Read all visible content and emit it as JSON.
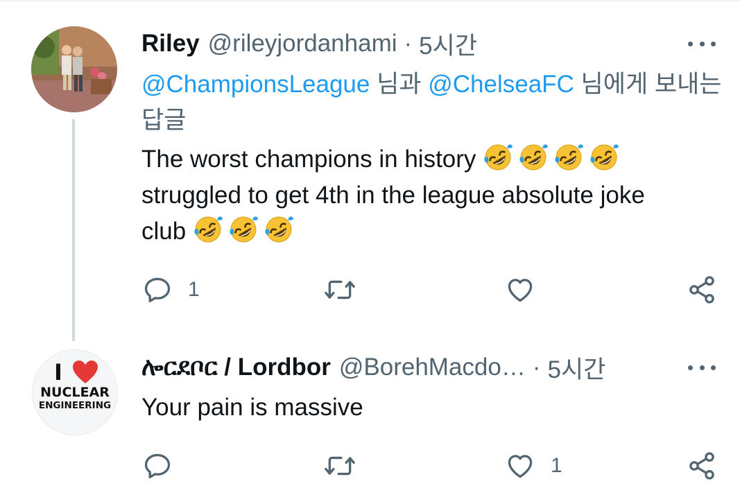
{
  "tweets": [
    {
      "name": "Riley",
      "handle": "@rileyjordanhami",
      "time": "5시간",
      "replying": {
        "mention1": "@ChampionsLeague",
        "joiner": " 님과 ",
        "mention2": "@ChelseaFC",
        "suffix": " 님에게 보내는 답글"
      },
      "text_line1": "The worst champions in history",
      "text_line2": "struggled to get 4th in the league absolute joke",
      "text_line3": "club",
      "emoji": "rolling-on-floor-laughing",
      "reply_count": "1",
      "like_count": ""
    },
    {
      "name": "ሎርደቦር / Lordbor",
      "handle": "@BorehMacdo…",
      "time": "5시간",
      "text": "Your pain is massive",
      "avatar_text": {
        "i": "I",
        "line1": "NUCLEAR",
        "line2": "ENGINEERING"
      },
      "reply_count": "",
      "like_count": "1"
    }
  ],
  "colors": {
    "accent": "#1d9bf0",
    "secondary": "#536471",
    "thread_line": "#cfd9de",
    "heart": "#e0245e"
  }
}
